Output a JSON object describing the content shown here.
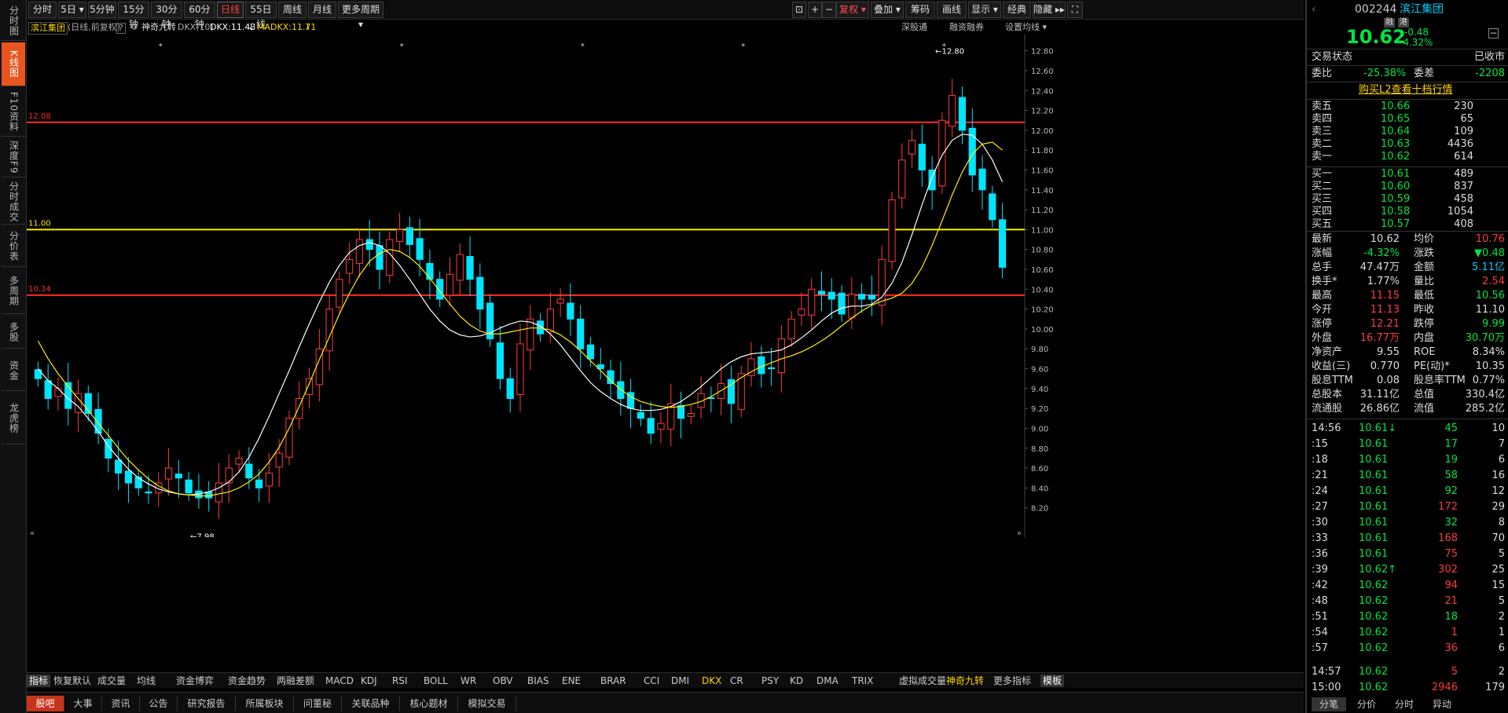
{
  "left_tabs": [
    {
      "label": "分时图",
      "active": false
    },
    {
      "label": "K线图",
      "active": true
    },
    {
      "label": "F10资料",
      "active": false
    },
    {
      "label": "深度F9",
      "active": false
    },
    {
      "label": "分时成交",
      "active": false
    },
    {
      "label": "分价表",
      "active": false
    },
    {
      "label": "多周期",
      "active": false
    },
    {
      "label": "多股",
      "active": false
    },
    {
      "label": "资金",
      "active": false
    },
    {
      "label": "龙虎榜",
      "active": false
    }
  ],
  "period_tabs": [
    "分时",
    "5日 ▾",
    "5分钟",
    "15分钟",
    "30分钟",
    "60分钟",
    "日线",
    "55日线",
    "周线",
    "月线",
    "更多周期 ▾"
  ],
  "active_period": "日线",
  "tools": {
    "restore": "复权 ▾",
    "overlay": "叠加 ▾",
    "chips": "筹码",
    "draw": "画线",
    "display": "显示 ▾",
    "classic": "经典",
    "hide": "隐藏 ▸▸"
  },
  "info": {
    "name": "滨江集团",
    "mode": "(日线,前复权)",
    "help": "?",
    "indicator": "神奇九转",
    "dkx_title": "DKX(10)",
    "dkx": "DKX:11.43",
    "madkx": "MADKX:11.71",
    "deep": "深股通",
    "margin": "融资融券",
    "setting": "设置均线 ▾"
  },
  "price_lines": {
    "upper": "12.08",
    "middle": "11.00",
    "lower": "10.34"
  },
  "annotations": {
    "high": "12.80",
    "low": "7.98"
  },
  "chart_data": {
    "type": "candlestick",
    "title": "滨江集团",
    "ylim": [
      8.0,
      12.9
    ],
    "y_ticks": [
      "12.80",
      "12.60",
      "12.40",
      "12.20",
      "12.00",
      "11.80",
      "11.60",
      "11.40",
      "11.20",
      "11.00",
      "10.80",
      "10.60",
      "10.40",
      "10.20",
      "10.00",
      "9.80",
      "9.60",
      "9.40",
      "9.20",
      "9.00",
      "8.80",
      "8.60",
      "8.40",
      "8.20"
    ],
    "series": [
      {
        "name": "DKX",
        "values": [
          9.6,
          9.48,
          9.4,
          9.3,
          9.22,
          9.1,
          8.97,
          8.82,
          8.7,
          8.59,
          8.5,
          8.44,
          8.39,
          8.36,
          8.34,
          8.33,
          8.34,
          8.36,
          8.4,
          8.46,
          8.56,
          8.71,
          8.9,
          9.12,
          9.35,
          9.58,
          9.82,
          10.05,
          10.27,
          10.47,
          10.64,
          10.77,
          10.84,
          10.87,
          10.84,
          10.76,
          10.64,
          10.5,
          10.35,
          10.2,
          10.08,
          9.99,
          9.94,
          9.92,
          9.93,
          9.96,
          10.01,
          10.05,
          10.08,
          10.07,
          10.03,
          9.95,
          9.84,
          9.71,
          9.58,
          9.46,
          9.37,
          9.3,
          9.24,
          9.2,
          9.18,
          9.18,
          9.19,
          9.22,
          9.27,
          9.34,
          9.42,
          9.51,
          9.6,
          9.67,
          9.72,
          9.75,
          9.76,
          9.77,
          9.79,
          9.84,
          9.91,
          9.99,
          10.08,
          10.16,
          10.21,
          10.23,
          10.23,
          10.25,
          10.32,
          10.46,
          10.67,
          10.95,
          11.25,
          11.53,
          11.75,
          11.9,
          11.96,
          11.95,
          11.86,
          11.7,
          11.48
        ]
      },
      {
        "name": "MADKX",
        "values": [
          9.88,
          9.7,
          9.55,
          9.42,
          9.3,
          9.18,
          9.05,
          8.93,
          8.8,
          8.68,
          8.58,
          8.49,
          8.42,
          8.37,
          8.34,
          8.33,
          8.32,
          8.32,
          8.34,
          8.36,
          8.4,
          8.46,
          8.54,
          8.66,
          8.81,
          9.0,
          9.22,
          9.45,
          9.69,
          9.92,
          10.15,
          10.36,
          10.54,
          10.68,
          10.76,
          10.8,
          10.78,
          10.72,
          10.63,
          10.51,
          10.38,
          10.25,
          10.13,
          10.04,
          9.98,
          9.95,
          9.95,
          9.97,
          9.99,
          10.01,
          10.01,
          9.99,
          9.94,
          9.87,
          9.78,
          9.68,
          9.58,
          9.48,
          9.39,
          9.32,
          9.27,
          9.24,
          9.22,
          9.21,
          9.22,
          9.24,
          9.27,
          9.32,
          9.38,
          9.44,
          9.51,
          9.57,
          9.62,
          9.66,
          9.7,
          9.73,
          9.77,
          9.82,
          9.88,
          9.95,
          10.03,
          10.11,
          10.18,
          10.24,
          10.28,
          10.31,
          10.36,
          10.46,
          10.62,
          10.84,
          11.09,
          11.35,
          11.58,
          11.76,
          11.86,
          11.88,
          11.8
        ]
      }
    ],
    "closes": [
      9.5,
      9.3,
      9.4,
      9.2,
      9.35,
      9.15,
      8.95,
      8.7,
      8.55,
      8.45,
      8.4,
      8.35,
      8.45,
      8.6,
      8.5,
      8.35,
      8.3,
      8.3,
      8.45,
      8.6,
      8.7,
      8.5,
      8.4,
      8.55,
      8.75,
      9.1,
      9.3,
      9.5,
      9.8,
      10.2,
      10.5,
      10.7,
      10.9,
      10.8,
      10.6,
      10.9,
      11.0,
      10.85,
      10.7,
      10.5,
      10.3,
      10.55,
      10.75,
      10.5,
      10.2,
      9.9,
      9.5,
      9.3,
      9.85,
      10.1,
      9.95,
      10.2,
      10.3,
      10.1,
      9.8,
      9.7,
      9.6,
      9.45,
      9.3,
      9.2,
      9.1,
      8.95,
      9.05,
      9.25,
      9.1,
      9.15,
      9.35,
      9.3,
      9.45,
      9.25,
      9.55,
      9.7,
      9.55,
      9.6,
      9.9,
      10.1,
      10.2,
      10.4,
      10.35,
      10.3,
      10.15,
      10.35,
      10.3,
      10.3,
      10.7,
      11.3,
      11.7,
      11.9,
      11.6,
      11.4,
      12.1,
      12.35,
      12.0,
      11.55,
      11.4,
      11.1,
      10.62
    ]
  },
  "quote": {
    "code": "002244",
    "name": "滨江集团",
    "tag1": "融",
    "tag2": "港",
    "price": "10.62",
    "change": "-0.48",
    "change_pct": "-4.32%",
    "status_label": "交易状态",
    "status_value": "已收市",
    "weibi_label": "委比",
    "weibi": "-25.38%",
    "weicha_label": "委差",
    "weicha": "-2208",
    "buy_l2": "购买L2查看十档行情"
  },
  "book": {
    "asks": [
      {
        "label": "卖五",
        "price": "10.66",
        "vol": "230"
      },
      {
        "label": "卖四",
        "price": "10.65",
        "vol": "65"
      },
      {
        "label": "卖三",
        "price": "10.64",
        "vol": "109"
      },
      {
        "label": "卖二",
        "price": "10.63",
        "vol": "4436"
      },
      {
        "label": "卖一",
        "price": "10.62",
        "vol": "614"
      }
    ],
    "bids": [
      {
        "label": "买一",
        "price": "10.61",
        "vol": "489"
      },
      {
        "label": "买二",
        "price": "10.60",
        "vol": "837"
      },
      {
        "label": "买三",
        "price": "10.59",
        "vol": "458"
      },
      {
        "label": "买四",
        "price": "10.58",
        "vol": "1054"
      },
      {
        "label": "买五",
        "price": "10.57",
        "vol": "408"
      }
    ]
  },
  "stats": [
    [
      "最新",
      "10.62",
      "均价",
      "10.76"
    ],
    [
      "涨幅",
      "-4.32%",
      "涨跌",
      "▼0.48"
    ],
    [
      "总手",
      "47.47万",
      "金额",
      "5.11亿"
    ],
    [
      "换手*",
      "1.77%",
      "量比",
      "2.54"
    ],
    [
      "最高",
      "11.15",
      "最低",
      "10.56"
    ],
    [
      "今开",
      "11.13",
      "昨收",
      "11.10"
    ],
    [
      "涨停",
      "12.21",
      "跌停",
      "9.99"
    ],
    [
      "外盘",
      "16.77万",
      "内盘",
      "30.70万"
    ],
    [
      "净资产",
      "9.55",
      "ROE",
      "8.34%"
    ],
    [
      "收益(三)",
      "0.770",
      "PE(动)*",
      "10.35"
    ],
    [
      "股息TTM",
      "0.08",
      "股息率TTM",
      "0.77%"
    ],
    [
      "总股本",
      "31.11亿",
      "总值",
      "330.4亿"
    ],
    [
      "流通股",
      "26.86亿",
      "流值",
      "285.2亿"
    ]
  ],
  "ticks": [
    [
      "14:56",
      "10.61↓",
      "45",
      "10"
    ],
    [
      ":15",
      "10.61",
      "17",
      "7"
    ],
    [
      ":18",
      "10.61",
      "19",
      "6"
    ],
    [
      ":21",
      "10.61",
      "58",
      "16"
    ],
    [
      ":24",
      "10.61",
      "92",
      "12"
    ],
    [
      ":27",
      "10.61",
      "172",
      "29"
    ],
    [
      ":30",
      "10.61",
      "32",
      "8"
    ],
    [
      ":33",
      "10.61",
      "168",
      "70"
    ],
    [
      ":36",
      "10.61",
      "75",
      "5"
    ],
    [
      ":39",
      "10.62↑",
      "302",
      "25"
    ],
    [
      ":42",
      "10.62",
      "94",
      "15"
    ],
    [
      ":48",
      "10.62",
      "21",
      "5"
    ],
    [
      ":51",
      "10.62",
      "18",
      "2"
    ],
    [
      ":54",
      "10.62",
      "1",
      "1"
    ],
    [
      ":57",
      "10.62",
      "36",
      "6"
    ],
    [
      "14:57",
      "10.62",
      "5",
      "2"
    ],
    [
      "15:00",
      "10.62",
      "2946",
      "179"
    ]
  ],
  "right_tabs": [
    "分笔",
    "分价",
    "分时",
    "异动"
  ],
  "indicators": [
    "指标",
    "恢复默认",
    "成交量",
    "均线",
    "资金博弈",
    "资金趋势",
    "两融差额",
    "MACD",
    "KDJ",
    "RSI",
    "BOLL",
    "WR",
    "OBV",
    "BIAS",
    "ENE",
    "BRAR",
    "CCI",
    "DMI",
    "DKX",
    "CR",
    "PSY",
    "KD",
    "DMA",
    "TRIX",
    "虚拟成交量",
    "神奇九转",
    "更多指标",
    "模板"
  ],
  "bottom_tabs": [
    "股吧",
    "大事",
    "资讯",
    "公告",
    "研究报告",
    "所属板块",
    "问董秘",
    "关联品种",
    "核心题材",
    "模拟交易"
  ]
}
